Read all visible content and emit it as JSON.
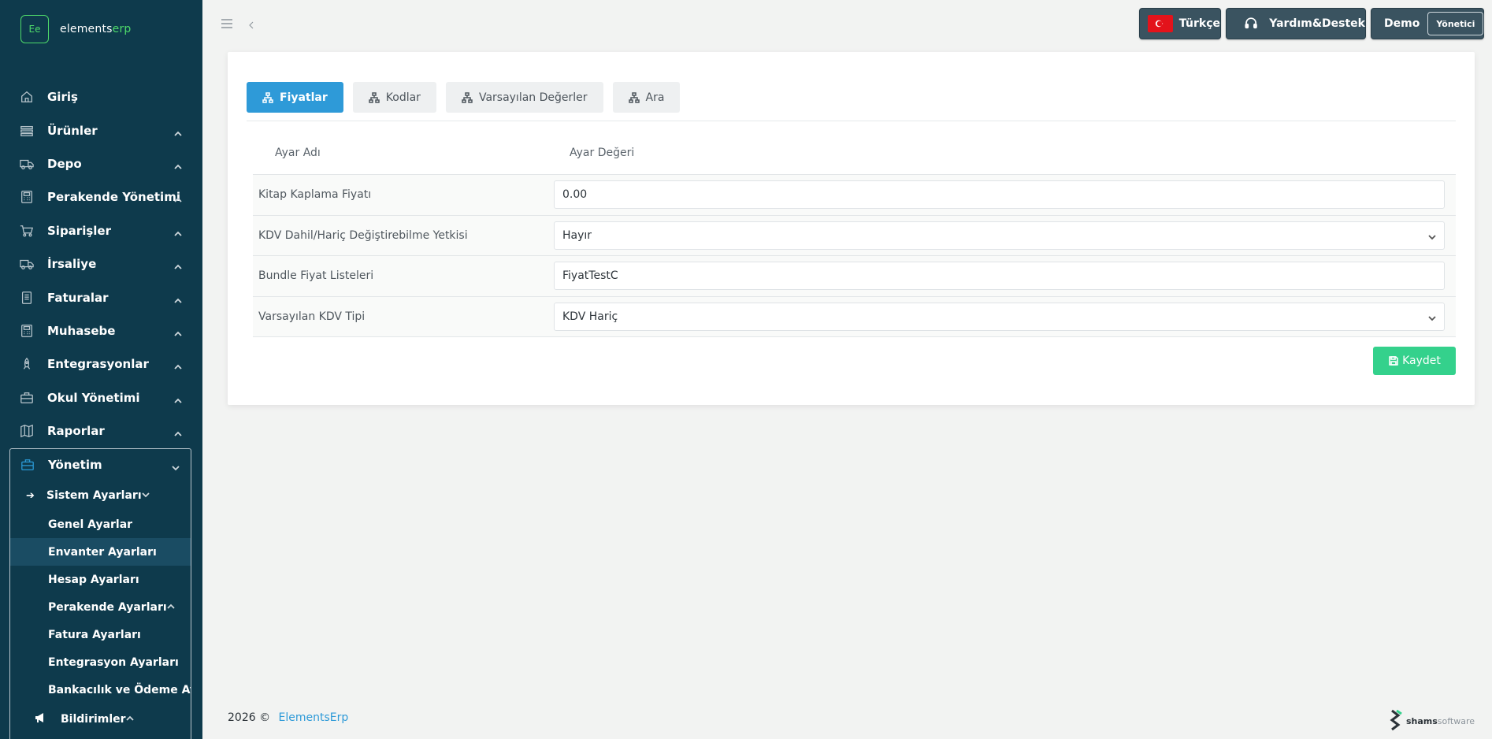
{
  "app": {
    "logo_mark": "Ee",
    "logo_name_main": "elements",
    "logo_name_accent": "erp",
    "brand_accent": "#4ed96a",
    "primary_color": "#2e9ad8",
    "sidebar_bg": "#0e3a4c"
  },
  "sidebar": {
    "items": [
      {
        "label": "Giriş",
        "icon": "home-icon"
      },
      {
        "label": "Ürünler",
        "icon": "list-icon"
      },
      {
        "label": "Depo",
        "icon": "truck-icon"
      },
      {
        "label": "Perakende Yönetimi",
        "icon": "calculator-icon"
      },
      {
        "label": "Siparişler",
        "icon": "cart-icon"
      },
      {
        "label": "İrsaliye",
        "icon": "truck-icon"
      },
      {
        "label": "Faturalar",
        "icon": "document-icon"
      },
      {
        "label": "Muhasebe",
        "icon": "calculator-icon"
      },
      {
        "label": "Entegrasyonlar",
        "icon": "rocket-icon"
      },
      {
        "label": "Okul Yönetimi",
        "icon": "briefcase-icon"
      },
      {
        "label": "Raporlar",
        "icon": "map-icon"
      }
    ],
    "yonetim": {
      "label": "Yönetim",
      "submenu_label": "Sistem Ayarları",
      "sub_items": [
        "Genel Ayarlar",
        "Envanter Ayarları",
        "Hesap Ayarları",
        "Perakende Ayarları",
        "Fatura Ayarları",
        "Entegrasyon Ayarları",
        "Bankacılık ve Ödeme Ayarları"
      ],
      "active_sub": "Envanter Ayarları",
      "notifications_label": "Bildirimler"
    }
  },
  "topbar": {
    "language": "Türkçe",
    "help": "Yardım&Destek",
    "user": "Demo",
    "role": "Yönetici"
  },
  "tabs": [
    {
      "label": "Fiyatlar",
      "active": true
    },
    {
      "label": "Kodlar",
      "active": false
    },
    {
      "label": "Varsayılan Değerler",
      "active": false
    },
    {
      "label": "Ara",
      "active": false
    }
  ],
  "table": {
    "col_name": "Ayar Adı",
    "col_value": "Ayar Değeri",
    "rows": [
      {
        "label": "Kitap Kaplama Fiyatı",
        "value": "0.00",
        "type": "input"
      },
      {
        "label": "KDV Dahil/Hariç Değiştirebilme Yetkisi",
        "value": "Hayır",
        "type": "select"
      },
      {
        "label": "Bundle Fiyat Listeleri",
        "value": "FiyatTestC",
        "type": "input"
      },
      {
        "label": "Varsayılan KDV Tipi",
        "value": "KDV Hariç",
        "type": "select"
      }
    ]
  },
  "actions": {
    "save": "Kaydet",
    "save_color": "#34d18c"
  },
  "footer": {
    "year": "2026 ©",
    "link": "ElementsErp",
    "brand_main": "shams",
    "brand_light": "software"
  }
}
